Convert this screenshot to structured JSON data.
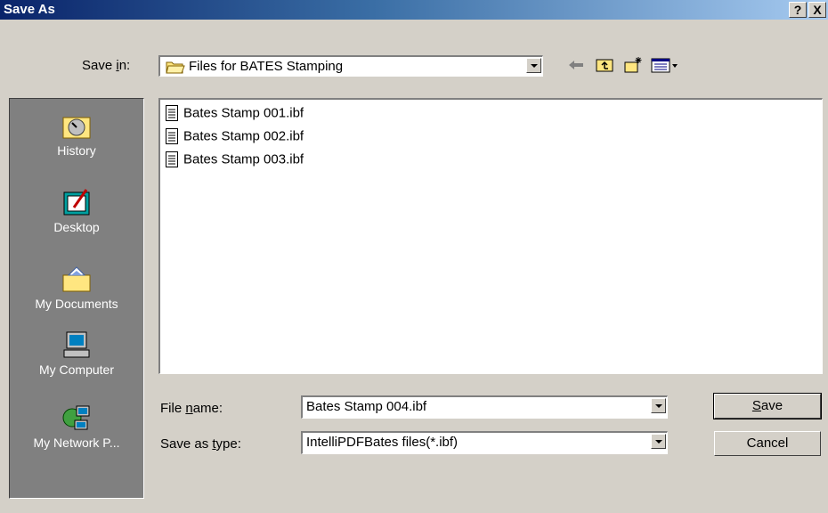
{
  "window": {
    "title": "Save As",
    "help_glyph": "?",
    "close_glyph": "X"
  },
  "toolbar": {
    "save_in_label_pre": "Save ",
    "save_in_label_key": "i",
    "save_in_label_post": "n:",
    "save_in_value": "Files for BATES Stamping",
    "icons": [
      "back-arrow-icon",
      "up-one-level-icon",
      "create-new-folder-icon",
      "views-menu-icon"
    ]
  },
  "places": [
    {
      "label": "History",
      "icon": "history-icon"
    },
    {
      "label": "Desktop",
      "icon": "desktop-icon"
    },
    {
      "label": "My Documents",
      "icon": "my-documents-icon"
    },
    {
      "label": "My Computer",
      "icon": "my-computer-icon"
    },
    {
      "label": "My Network P...",
      "icon": "my-network-places-icon"
    }
  ],
  "files": [
    {
      "name": "Bates Stamp 001.ibf"
    },
    {
      "name": "Bates Stamp 002.ibf"
    },
    {
      "name": "Bates Stamp 003.ibf"
    }
  ],
  "form": {
    "file_name_label_pre": "File ",
    "file_name_label_key": "n",
    "file_name_label_post": "ame:",
    "file_name_value": "Bates Stamp 004.ibf",
    "save_as_type_label_pre": "Save as ",
    "save_as_type_label_key": "t",
    "save_as_type_label_post": "ype:",
    "save_as_type_value": "IntelliPDFBates files(*.ibf)"
  },
  "buttons": {
    "save_key": "S",
    "save_rest": "ave",
    "cancel": "Cancel"
  },
  "colors": {
    "title_start": "#0a246a",
    "title_end": "#a6caf0",
    "face": "#d4d0c8",
    "places_bg": "#808080"
  }
}
